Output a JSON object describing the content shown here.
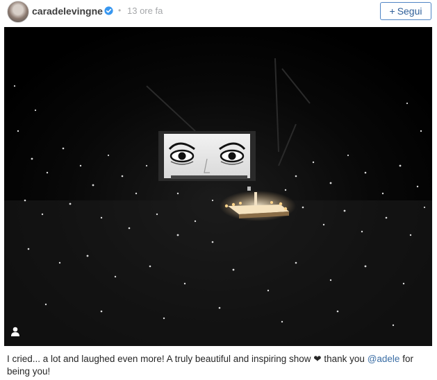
{
  "header": {
    "username": "caradelevingne",
    "dot": "•",
    "timestamp": "13 ore fa",
    "follow_label": "Segui",
    "follow_plus": "+"
  },
  "photo": {
    "icons": {
      "verified": "verified-badge-icon",
      "tag": "user-tag-icon"
    },
    "colors": {
      "background": "#000000",
      "stage_light": "#f2c487"
    }
  },
  "caption": {
    "text_before": "I cried... a lot and laughed even more! A truly beautiful and inspiring show",
    "heart": "❤",
    "text_middle": "thank you",
    "mention": "@adele",
    "text_after": "for being you!"
  }
}
